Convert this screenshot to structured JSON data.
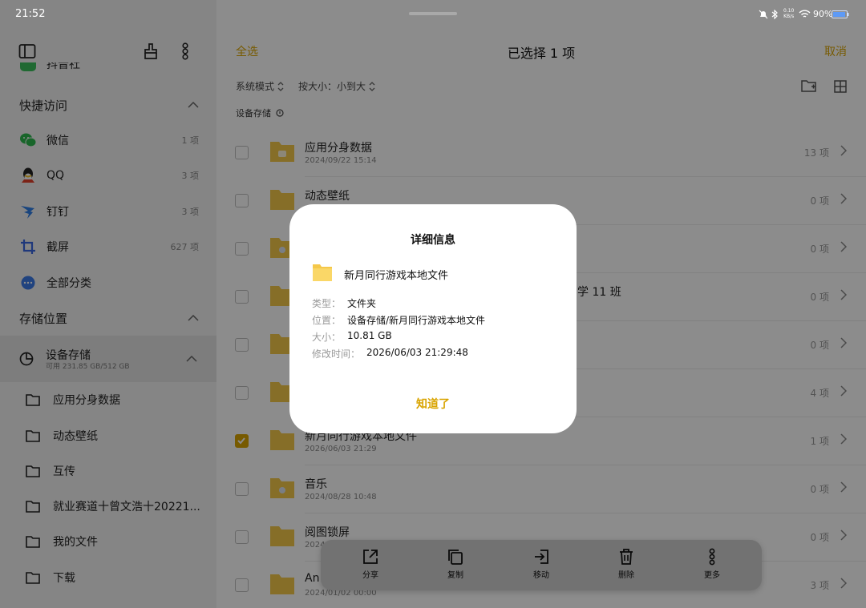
{
  "status": {
    "time": "21:52",
    "net_speed_top": "0.10",
    "net_speed_bottom": "KB/s",
    "battery": "90%"
  },
  "sidebar": {
    "partial_item": "抖音社",
    "quick_access": {
      "title": "快捷访问",
      "items": [
        {
          "label": "微信",
          "count": "1 项",
          "icon": "wechat-icon"
        },
        {
          "label": "QQ",
          "count": "3 项",
          "icon": "qq-icon"
        },
        {
          "label": "钉钉",
          "count": "3 项",
          "icon": "dingtalk-icon"
        },
        {
          "label": "截屏",
          "count": "627 项",
          "icon": "crop-icon"
        },
        {
          "label": "全部分类",
          "count": "",
          "icon": "more-dots-icon"
        }
      ]
    },
    "storage": {
      "title": "存储位置",
      "device": "设备存储",
      "device_sub": "可用 231.85 GB/512 GB"
    },
    "folders": [
      "应用分身数据",
      "动态壁纸",
      "互传",
      "就业赛道十曾文浩十20221...",
      "我的文件",
      "下载"
    ]
  },
  "topbar": {
    "select_all": "全选",
    "title": "已选择 1 项",
    "cancel": "取消"
  },
  "filters": {
    "mode": "系统模式",
    "sort": "按大小：小到大"
  },
  "breadcrumb": "设备存储",
  "rows": [
    {
      "name": "应用分身数据",
      "date": "2024/09/22 15:14",
      "count": "13 项",
      "checked": false
    },
    {
      "name": "动态壁纸",
      "date": "",
      "count": "0 项",
      "checked": false
    },
    {
      "name": "",
      "date": "",
      "count": "0 项",
      "checked": false
    },
    {
      "name": "学 11 班",
      "date": "",
      "count": "0 项",
      "checked": false
    },
    {
      "name": "",
      "date": "",
      "count": "0 项",
      "checked": false
    },
    {
      "name": "",
      "date": "",
      "count": "4 项",
      "checked": false
    },
    {
      "name": "新月同行游戏本地文件",
      "date": "2026/06/03 21:29",
      "count": "1 项",
      "checked": true
    },
    {
      "name": "音乐",
      "date": "2024/08/28 10:48",
      "count": "0 项",
      "checked": false
    },
    {
      "name": "阅图锁屏",
      "date": "2024/",
      "count": "0 项",
      "checked": false
    },
    {
      "name": "An",
      "date": "2024/01/02 00:00",
      "count": "3 项",
      "checked": false
    }
  ],
  "actions": [
    {
      "label": "分享",
      "icon": "share-icon"
    },
    {
      "label": "复制",
      "icon": "copy-icon"
    },
    {
      "label": "移动",
      "icon": "move-icon"
    },
    {
      "label": "删除",
      "icon": "trash-icon"
    },
    {
      "label": "更多",
      "icon": "more-vertical-icon"
    }
  ],
  "dialog": {
    "title": "详细信息",
    "file_name": "新月同行游戏本地文件",
    "type_key": "类型：",
    "type_value": "文件夹",
    "location_key": "位置：",
    "location_value": "设备存储/新月同行游戏本地文件",
    "size_key": "大小：",
    "size_value": "10.81 GB",
    "modified_key": "修改时间：",
    "modified_value": "2026/06/03 21:29:48",
    "ok": "知道了"
  },
  "colors": {
    "accent": "#d9a400",
    "folder": "#f5c84a",
    "sidebar_bg": "#f2f2f2"
  }
}
